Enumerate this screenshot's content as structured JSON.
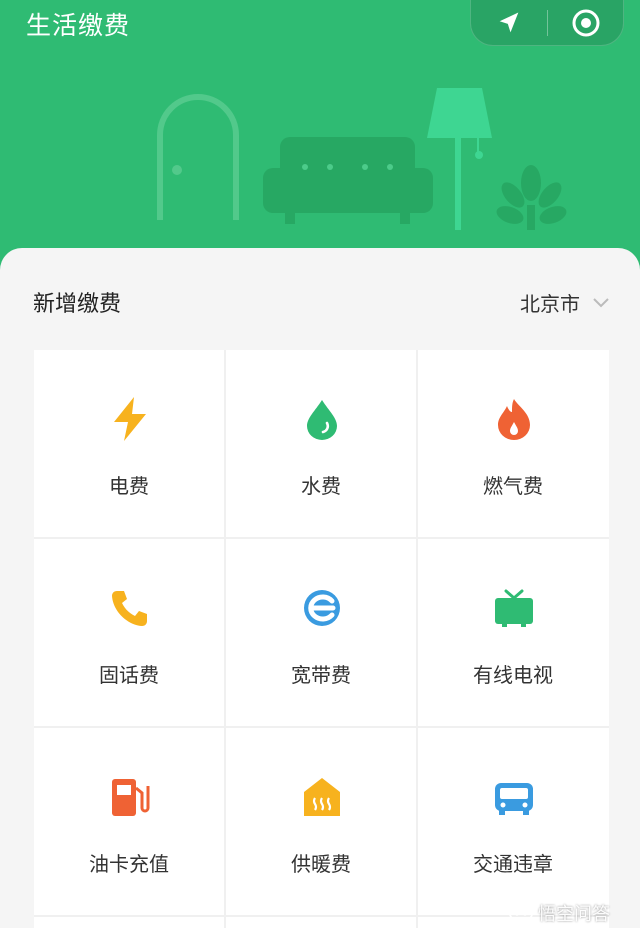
{
  "header": {
    "title": "生活缴费",
    "bg_color": "#2fbb73",
    "capsule": {
      "left_icon": "location-arrow-icon",
      "right_icon": "target-icon"
    }
  },
  "section": {
    "title": "新增缴费",
    "city": "北京市",
    "city_icon": "chevron-down-icon"
  },
  "services": [
    {
      "label": "电费",
      "icon": "lightning-icon",
      "color": "#f7b21e"
    },
    {
      "label": "水费",
      "icon": "water-drop-icon",
      "color": "#2fbb73"
    },
    {
      "label": "燃气费",
      "icon": "flame-icon",
      "color": "#ef6234"
    },
    {
      "label": "固话费",
      "icon": "phone-icon",
      "color": "#f7b21e"
    },
    {
      "label": "宽带费",
      "icon": "broadband-e-icon",
      "color": "#3a9be0"
    },
    {
      "label": "有线电视",
      "icon": "tv-icon",
      "color": "#2fbb73"
    },
    {
      "label": "油卡充值",
      "icon": "fuel-pump-icon",
      "color": "#ef6234"
    },
    {
      "label": "供暖费",
      "icon": "heating-house-icon",
      "color": "#f7b21e"
    },
    {
      "label": "交通违章",
      "icon": "car-icon",
      "color": "#3a9be0"
    }
  ],
  "watermark": {
    "text": "悟空问答",
    "icon": "wukong-icon"
  }
}
